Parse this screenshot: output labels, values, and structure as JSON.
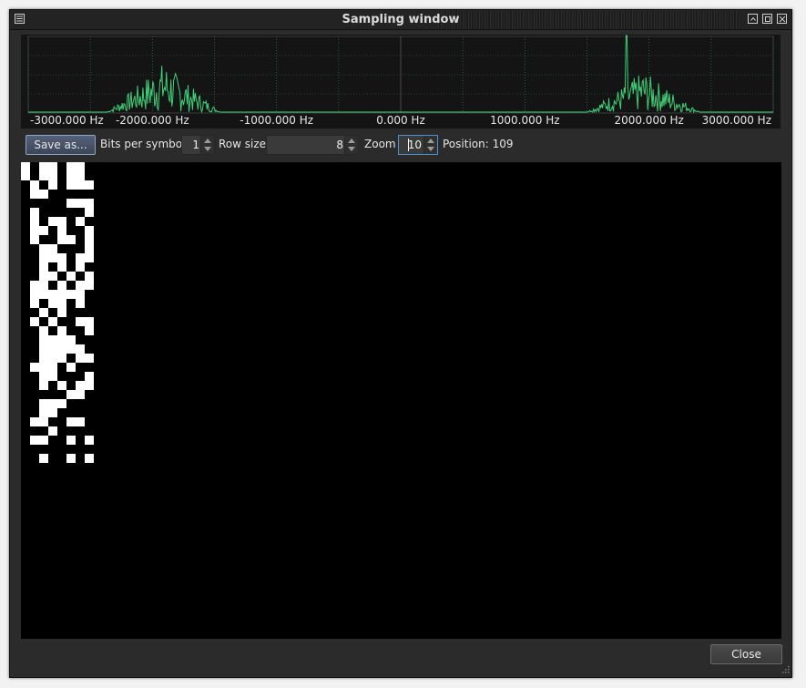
{
  "window": {
    "title": "Sampling window"
  },
  "spectrum": {
    "ticks": [
      "-3000.000 Hz",
      "-2000.000 Hz",
      "-1000.000 Hz",
      "0.000 Hz",
      "1000.000 Hz",
      "2000.000 Hz",
      "3000.000 Hz"
    ],
    "line_color": "#3ecf78",
    "grid_color": "#2e6b4a"
  },
  "toolbar": {
    "save_label": "Save as...",
    "bits_label": "Bits per symbol",
    "bits_value": "1",
    "rowsize_label": "Row size",
    "rowsize_value": "8",
    "zoom_label": "Zoom",
    "zoom_value": "10",
    "position_text": "Position: 109"
  },
  "footer": {
    "close_label": "Close"
  },
  "bitmap": {
    "rows": [
      "10110110",
      "10110110",
      "01010111",
      "01100000",
      "00000111",
      "01000001",
      "01011010",
      "01101001",
      "01001101",
      "00110001",
      "00111011",
      "00101010",
      "00110101",
      "01101011",
      "01111110",
      "01011010",
      "00101000",
      "01010011",
      "00101001",
      "00111100",
      "00111110",
      "00111011",
      "01110100",
      "00110001",
      "00101011",
      "00000110",
      "00111000",
      "00110000",
      "01100110",
      "00010000",
      "01100101",
      "00000000",
      "00100101"
    ]
  }
}
